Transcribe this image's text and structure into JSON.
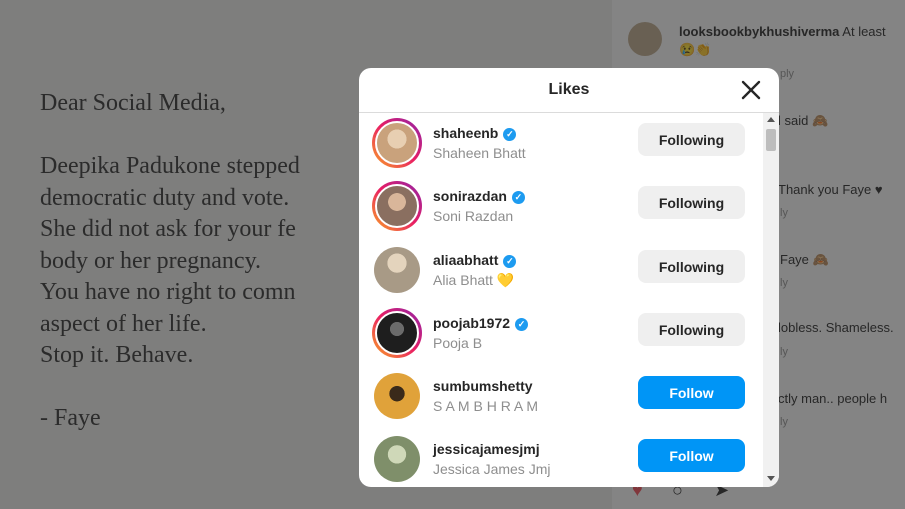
{
  "post": {
    "lines": [
      "Dear Social Media,",
      "",
      "Deepika Padukone stepped",
      "democratic duty and vote.",
      "She did not ask for your fe",
      "body or her pregnancy.",
      "You have no right to comn",
      "aspect of her life.",
      "Stop it. Behave.",
      "",
      "- Faye"
    ]
  },
  "comments": {
    "top_user": "looksbookbykhushiverma",
    "top_text": "At least",
    "top_emoji": "😢👏",
    "items": [
      {
        "text": "ply"
      },
      {
        "text": "l said 🙈"
      },
      {
        "text": "Thank you Faye ♥"
      },
      {
        "text": "ly"
      },
      {
        "text": "Faye 🙈"
      },
      {
        "text": "ly"
      },
      {
        "text": "lobless. Shameless."
      },
      {
        "text": "ly"
      },
      {
        "text": "ctly man.. people h"
      },
      {
        "text": "ly"
      }
    ]
  },
  "modal": {
    "title": "Likes",
    "close_glyph": "✕",
    "users": [
      {
        "username": "shaheenb",
        "fullname": "Shaheen Bhatt",
        "verified": true,
        "button": "Following",
        "avatar_color": "#c9a27c",
        "story": true
      },
      {
        "username": "sonirazdan",
        "fullname": "Soni Razdan",
        "verified": true,
        "button": "Following",
        "avatar_color": "#8a6f60",
        "story": true
      },
      {
        "username": "aliaabhatt",
        "fullname": "Alia Bhatt 💛",
        "verified": true,
        "button": "Following",
        "avatar_color": "#a89a86",
        "story": false
      },
      {
        "username": "poojab1972",
        "fullname": "Pooja B",
        "verified": true,
        "button": "Following",
        "avatar_color": "#2a2a2a",
        "story": true
      },
      {
        "username": "sumbumshetty",
        "fullname": "S A M B H R A M",
        "verified": false,
        "button": "Follow",
        "avatar_color": "#e0a23a",
        "story": false
      },
      {
        "username": "jessicajamesjmj",
        "fullname": "Jessica James Jmj",
        "verified": false,
        "button": "Follow",
        "avatar_color": "#7f8f6a",
        "story": false
      }
    ]
  },
  "colors": {
    "follow_blue": "#0095f6",
    "following_gray": "#efefef",
    "verified_blue": "#1d9bf0"
  }
}
